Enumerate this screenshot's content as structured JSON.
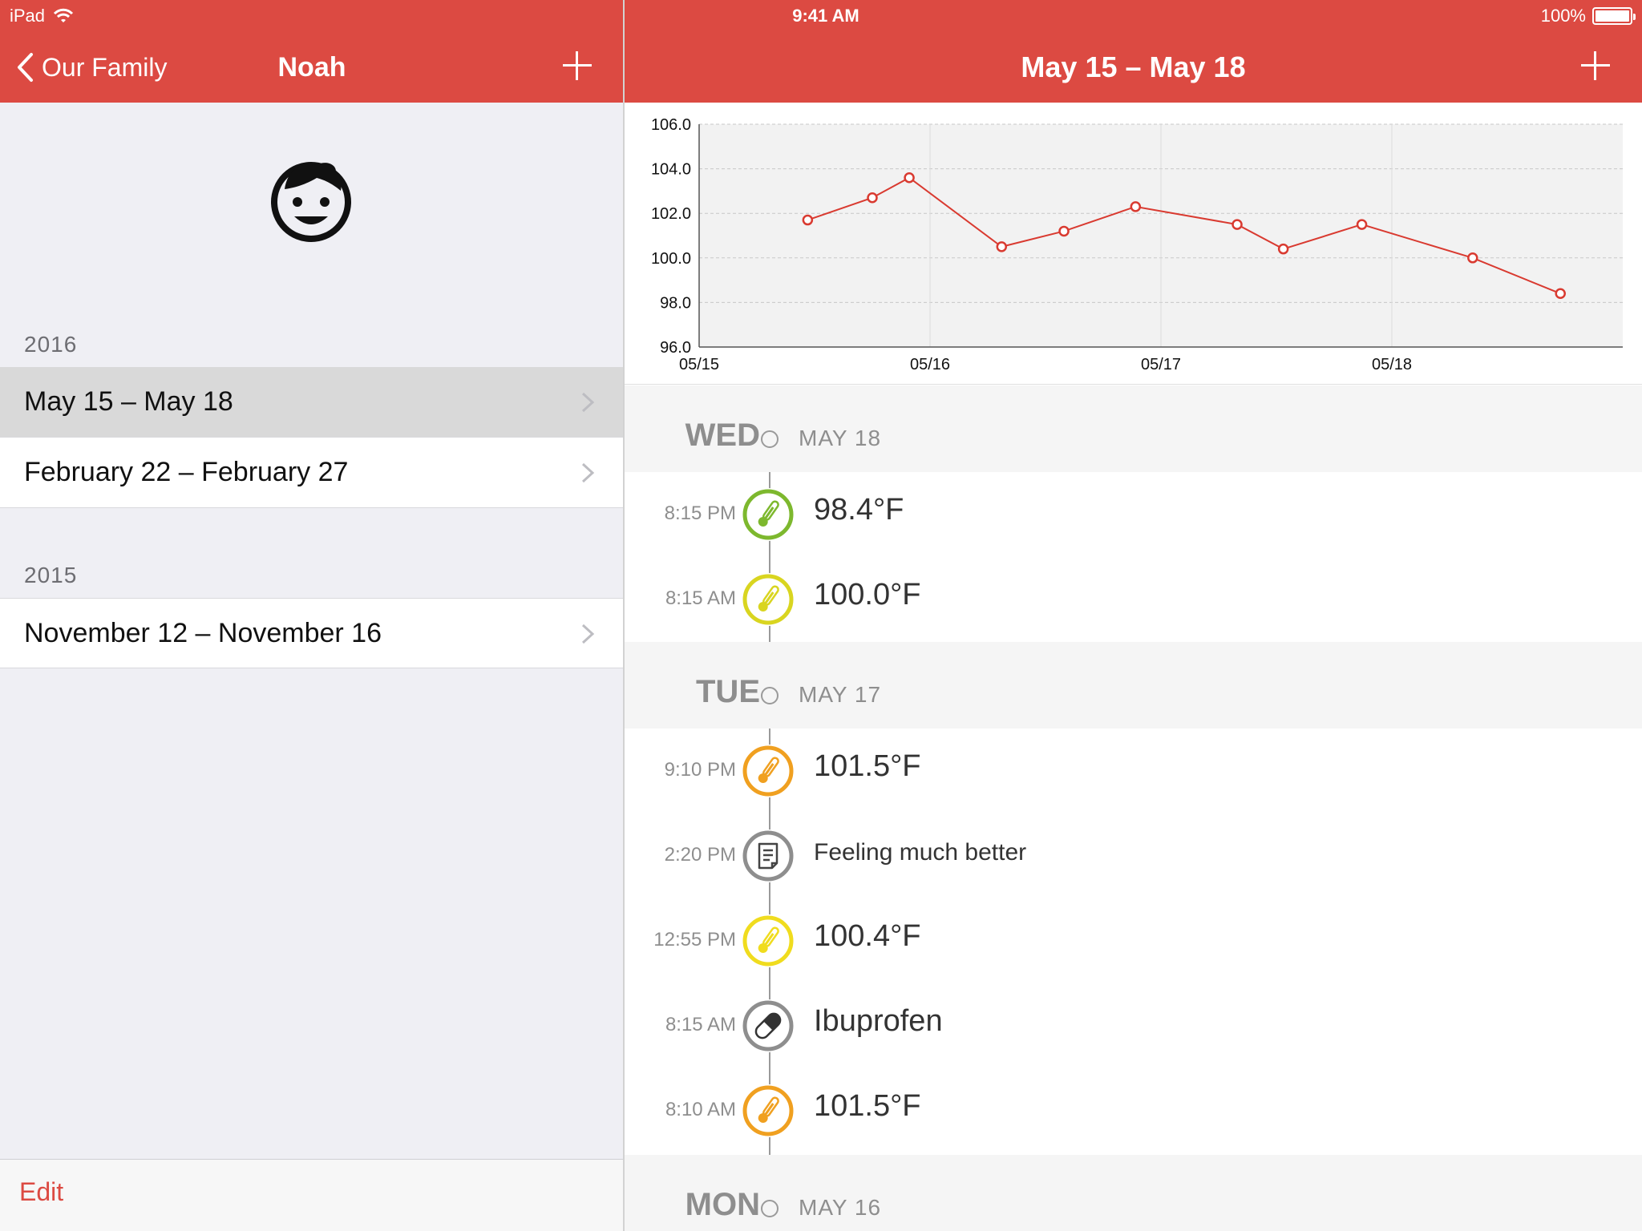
{
  "status_bar": {
    "carrier": "iPad",
    "time": "9:41 AM",
    "battery": "100%",
    "battery_level": 1.0
  },
  "left_nav": {
    "back_label": "Our Family",
    "title": "Noah"
  },
  "right_nav": {
    "title": "May 15 – May 18"
  },
  "sections": [
    {
      "year": "2016",
      "items": [
        {
          "label": "May 15 – May 18",
          "selected": true
        },
        {
          "label": "February 22 – February 27",
          "selected": false
        }
      ]
    },
    {
      "year": "2015",
      "items": [
        {
          "label": "November 12 – November 16",
          "selected": false
        }
      ]
    }
  ],
  "footer": {
    "edit_label": "Edit"
  },
  "chart_data": {
    "type": "line",
    "title": "",
    "xlabel": "",
    "ylabel": "",
    "ylim": [
      96,
      106
    ],
    "xlim": [
      0,
      4
    ],
    "y_ticks": [
      "96.0",
      "98.0",
      "100.0",
      "102.0",
      "104.0",
      "106.0"
    ],
    "x_tick_labels": [
      "05/15",
      "05/16",
      "05/17",
      "05/18"
    ],
    "x_tick_positions": [
      0,
      1,
      2,
      3
    ],
    "grid": true,
    "series": [
      {
        "color": "#D93A30",
        "points": [
          {
            "x": 0.47,
            "y": 101.7
          },
          {
            "x": 0.75,
            "y": 102.7
          },
          {
            "x": 0.91,
            "y": 103.6
          },
          {
            "x": 1.31,
            "y": 100.5
          },
          {
            "x": 1.58,
            "y": 101.2
          },
          {
            "x": 1.89,
            "y": 102.3
          },
          {
            "x": 2.33,
            "y": 101.5
          },
          {
            "x": 2.53,
            "y": 100.4
          },
          {
            "x": 2.87,
            "y": 101.5
          },
          {
            "x": 3.35,
            "y": 100.0
          },
          {
            "x": 3.73,
            "y": 98.4
          }
        ]
      }
    ]
  },
  "timeline": {
    "days": [
      {
        "day": "WED",
        "date": "MAY 18",
        "entries": [
          {
            "time": "8:15 PM",
            "kind": "temp",
            "value": "98.4°F",
            "color": "#7DB82E"
          },
          {
            "time": "8:15 AM",
            "kind": "temp",
            "value": "100.0°F",
            "color": "#D9D520"
          }
        ]
      },
      {
        "day": "TUE",
        "date": "MAY 17",
        "entries": [
          {
            "time": "9:10 PM",
            "kind": "temp",
            "value": "101.5°F",
            "color": "#F0A020"
          },
          {
            "time": "2:20 PM",
            "kind": "note",
            "value": "Feeling much better",
            "color": "#8E8E8E"
          },
          {
            "time": "12:55 PM",
            "kind": "temp",
            "value": "100.4°F",
            "color": "#F0DC1E"
          },
          {
            "time": "8:15 AM",
            "kind": "med",
            "value": "Ibuprofen",
            "color": "#8E8E8E"
          },
          {
            "time": "8:10 AM",
            "kind": "temp",
            "value": "101.5°F",
            "color": "#F0A020"
          }
        ]
      },
      {
        "day": "MON",
        "date": "MAY 16",
        "entries": []
      }
    ]
  },
  "icons": {
    "back": "chevron-left-icon",
    "add": "plus-icon",
    "wifi": "wifi-icon",
    "battery": "battery-icon",
    "avatar": "child-face-icon",
    "disclosure": "chevron-right-icon",
    "temp": "thermometer-icon",
    "note": "note-icon",
    "med": "pill-icon"
  }
}
